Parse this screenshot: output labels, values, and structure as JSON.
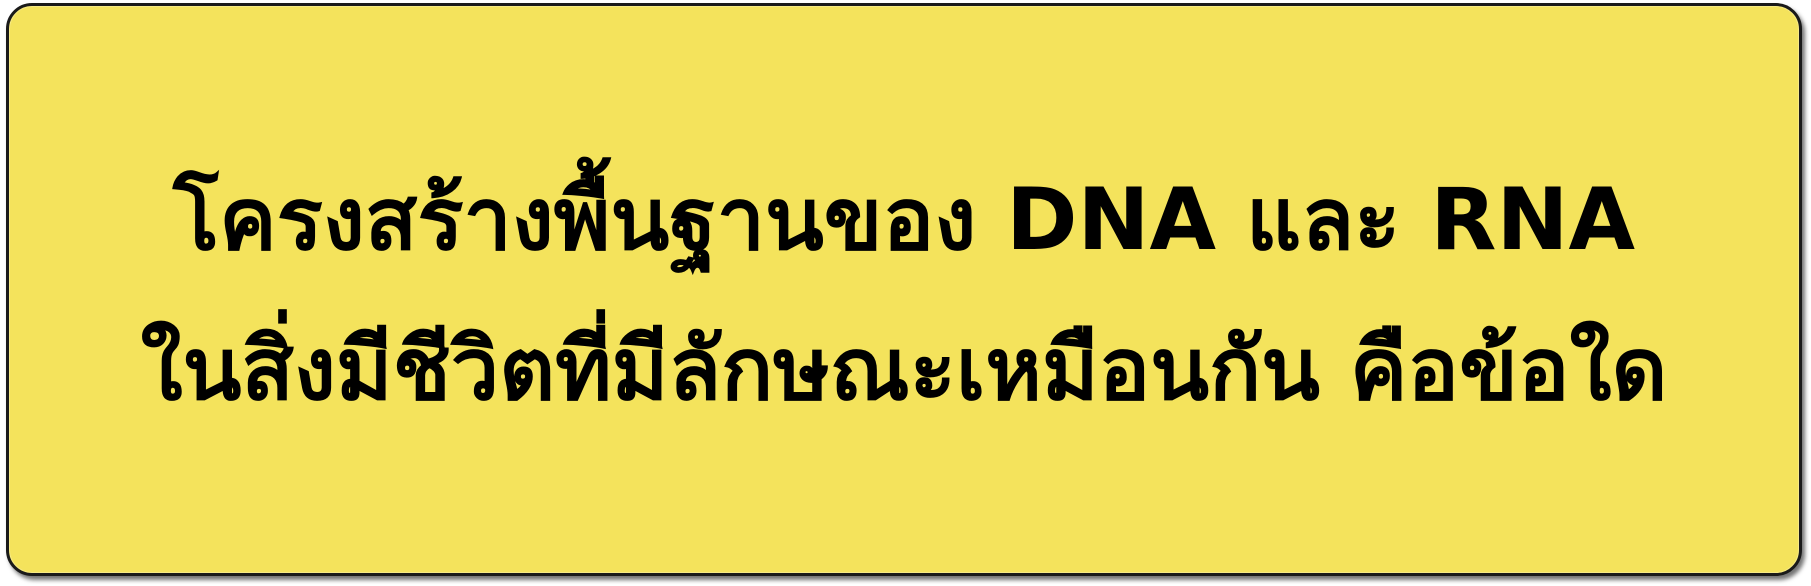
{
  "banner": {
    "line1": "โครงสร้างพื้นฐานของ DNA และ RNA",
    "line2": "ในสิ่งมีชีวิตที่มีลักษณะเหมือนกัน คือข้อใด",
    "background_color": "#f4e35c",
    "text_color": "#000000",
    "border_color": "#1a1a1a"
  }
}
